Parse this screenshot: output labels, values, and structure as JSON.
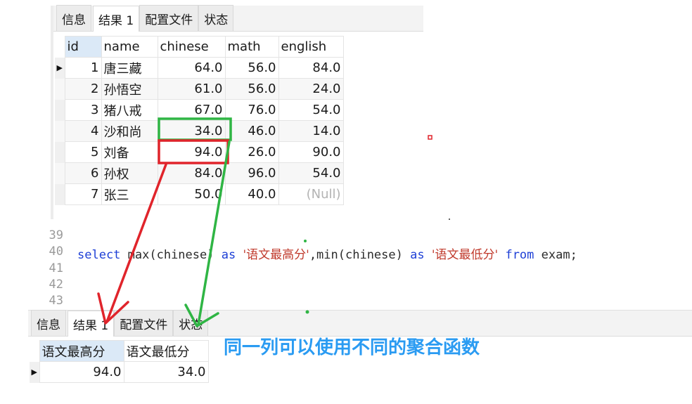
{
  "top_panel": {
    "tabs": [
      "信息",
      "结果 1",
      "配置文件",
      "状态"
    ],
    "active_tab": 1,
    "columns": [
      "id",
      "name",
      "chinese",
      "math",
      "english"
    ],
    "rows": [
      {
        "id": "1",
        "name": "唐三藏",
        "chinese": "64.0",
        "math": "56.0",
        "english": "84.0"
      },
      {
        "id": "2",
        "name": "孙悟空",
        "chinese": "61.0",
        "math": "56.0",
        "english": "24.0"
      },
      {
        "id": "3",
        "name": "猪八戒",
        "chinese": "67.0",
        "math": "76.0",
        "english": "54.0"
      },
      {
        "id": "4",
        "name": "沙和尚",
        "chinese": "34.0",
        "math": "46.0",
        "english": "14.0"
      },
      {
        "id": "5",
        "name": "刘备",
        "chinese": "94.0",
        "math": "26.0",
        "english": "90.0"
      },
      {
        "id": "6",
        "name": "孙权",
        "chinese": "84.0",
        "math": "96.0",
        "english": "54.0"
      },
      {
        "id": "7",
        "name": "张三",
        "chinese": "50.0",
        "math": "40.0",
        "english": "(Null)"
      }
    ]
  },
  "editor": {
    "lines": [
      {
        "num": "39",
        "code": ""
      },
      {
        "num": "40",
        "code": "select max(chinese) as '语文最高分',min(chinese) as '语文最低分' from exam;"
      },
      {
        "num": "41",
        "code": ""
      },
      {
        "num": "42",
        "code": ""
      },
      {
        "num": "43",
        "code": ""
      }
    ],
    "tokens": {
      "select": "select",
      "max_call": " max(chinese) ",
      "as1": "as",
      "str1": "'语文最高分'",
      "min_call": ",min(chinese) ",
      "as2": "as",
      "str2": "'语文最低分'",
      "from": "from",
      "tail": " exam;"
    }
  },
  "bottom_panel": {
    "tabs": [
      "信息",
      "结果 1",
      "配置文件",
      "状态"
    ],
    "active_tab": 1,
    "columns": [
      "语文最高分",
      "语文最低分"
    ],
    "rows": [
      {
        "max": "94.0",
        "min": "34.0"
      }
    ]
  },
  "annotation": {
    "text": "同一列可以使用不同的聚合函数",
    "color": "#2a9bf2"
  },
  "colors": {
    "red_highlight": "#e0242b",
    "green_highlight": "#2fb544",
    "keyword": "#1d3fd6",
    "string": "#c0392b"
  }
}
